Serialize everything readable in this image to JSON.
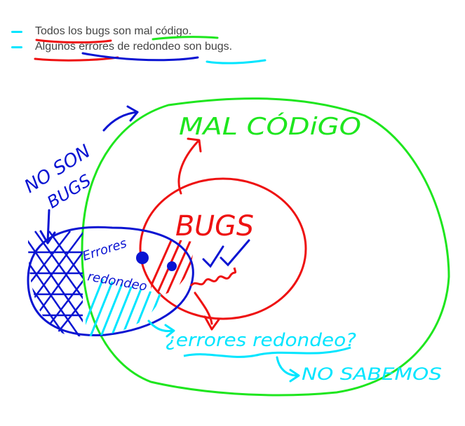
{
  "premises": [
    {
      "text": "Todos los bugs son mal código.",
      "bullet_color": "#00e5ff"
    },
    {
      "text": "Algunos errores de redondeo son bugs.",
      "bullet_color": "#00e5ff"
    }
  ],
  "labels": {
    "mal_codigo": "MAL CÓDiGO",
    "bugs": "BUGS",
    "no_son_bugs_1": "NO SON",
    "no_son_bugs_2": "BUGS",
    "errores_redondeo_1": "Errores",
    "errores_redondeo_2": "redondeo",
    "question": "¿errores redondeo?",
    "no_sabemos": "NO SABEMOS"
  },
  "colors": {
    "mal_codigo": "#1ee61e",
    "bugs": "#ee1111",
    "errores": "#0a14d2",
    "unknown": "#00e5ff",
    "text": "#444444"
  }
}
